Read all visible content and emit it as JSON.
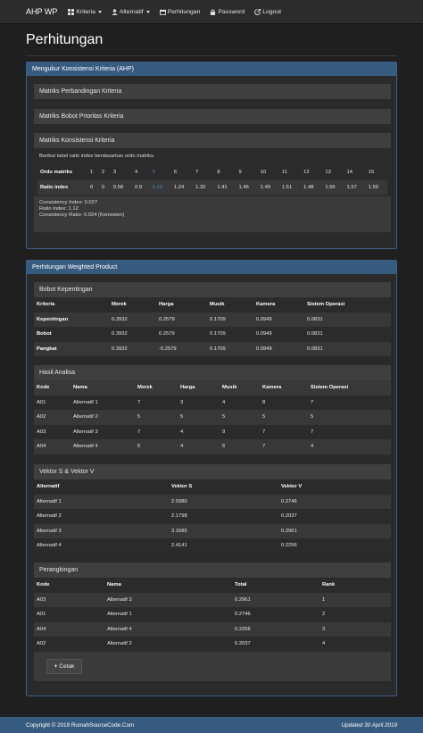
{
  "nav": {
    "brand": "AHP WP",
    "items": [
      {
        "label": "Kriteria",
        "icon": "grid-icon",
        "dropdown": true
      },
      {
        "label": "Alternatif",
        "icon": "user-icon",
        "dropdown": true
      },
      {
        "label": "Perhitungan",
        "icon": "calendar-icon",
        "dropdown": false
      },
      {
        "label": "Password",
        "icon": "lock-icon",
        "dropdown": false
      },
      {
        "label": "Logout",
        "icon": "logout-icon",
        "dropdown": false
      }
    ]
  },
  "page_title": "Perhitungan",
  "ahp_panel": {
    "title": "Mengukur Konsistensi Kriteria (AHP)",
    "sections": [
      "Matriks Perbandingan Kriteria",
      "Matriks Bobot Prioritas Kriteria",
      "Matriks Konsistensi Kriteria"
    ],
    "ratio_note": "Berikut tabel ratio index berdasarkan ordo matriks.",
    "ordo_label": "Ordo matriks",
    "ri_label": "Ratio index",
    "ordo": [
      "1",
      "2",
      "3",
      "4",
      "5",
      "6",
      "7",
      "8",
      "9",
      "10",
      "11",
      "12",
      "13",
      "14",
      "15"
    ],
    "ri": [
      "0",
      "0",
      "0.58",
      "0.9",
      "1.12",
      "1.24",
      "1.32",
      "1.41",
      "1.46",
      "1.49",
      "1.51",
      "1.48",
      "1.56",
      "1.57",
      "1.59"
    ],
    "ci": "Consistency Index: 0.027",
    "ri_text": "Ratio Index: 1.12",
    "cr": "Consistency Ratio: 0.024 (Konsisten)"
  },
  "wp_panel": {
    "title": "Perhitungan Weighted Product",
    "bobot": {
      "title": "Bobot Kepentingan",
      "headers": [
        "Kriteria",
        "Merek",
        "Harga",
        "Musik",
        "Kamera",
        "Sistem Operasi"
      ],
      "rows": [
        [
          "Kepentingan",
          "0.3932",
          "0.2579",
          "0.1709",
          "0.0949",
          "0.0831"
        ],
        [
          "Bobot",
          "0.3932",
          "0.2579",
          "0.1709",
          "0.0949",
          "0.0831"
        ],
        [
          "Pangkat",
          "0.3932",
          "-0.2579",
          "0.1709",
          "0.0949",
          "0.0831"
        ]
      ]
    },
    "analisa": {
      "title": "Hasil Analisa",
      "headers": [
        "Kode",
        "Nama",
        "Merek",
        "Harga",
        "Musik",
        "Kamera",
        "Sistem Operasi"
      ],
      "rows": [
        [
          "A01",
          "Alternatif 1",
          "7",
          "3",
          "4",
          "8",
          "7"
        ],
        [
          "A02",
          "Alternatif 2",
          "5",
          "5",
          "5",
          "5",
          "5"
        ],
        [
          "A03",
          "Alternatif 3",
          "7",
          "4",
          "9",
          "7",
          "7"
        ],
        [
          "A04",
          "Alternatif 4",
          "5",
          "4",
          "6",
          "7",
          "4"
        ]
      ]
    },
    "vektor": {
      "title": "Vektor S & Vektor V",
      "headers": [
        "Alternatif",
        "Vektor S",
        "Vektor V"
      ],
      "rows": [
        [
          "Alternatif 1",
          "2.9380",
          "0.2746"
        ],
        [
          "Alternatif 2",
          "2.1798",
          "0.2037"
        ],
        [
          "Alternatif 3",
          "3.1685",
          "0.2961"
        ],
        [
          "Alternatif 4",
          "2.4141",
          "0.2256"
        ]
      ]
    },
    "rank": {
      "title": "Perangkingan",
      "headers": [
        "Kode",
        "Nama",
        "Total",
        "Rank"
      ],
      "rows": [
        [
          "A03",
          "Alternatif 3",
          "0.2961",
          "1"
        ],
        [
          "A01",
          "Alternatif 1",
          "0.2746",
          "2"
        ],
        [
          "A04",
          "Alternatif 4",
          "0.2256",
          "3"
        ],
        [
          "A02",
          "Alternatif 2",
          "0.2037",
          "4"
        ]
      ]
    },
    "cetak_label": "Cetak"
  },
  "footer": {
    "left": "Copyright © 2019 RumahSourceCode.Com",
    "right": "Updated 30 April 2019"
  }
}
